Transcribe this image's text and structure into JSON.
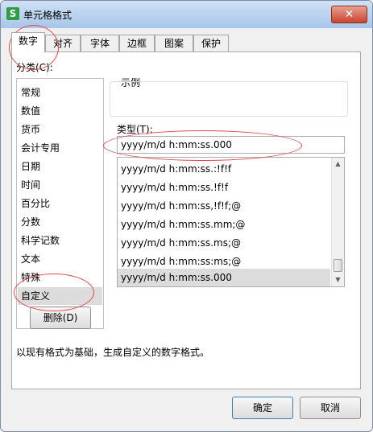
{
  "window": {
    "title": "单元格格式",
    "app_icon": "S",
    "close_glyph": "✕"
  },
  "tabs": [
    {
      "label": "数字",
      "active": true
    },
    {
      "label": "对齐"
    },
    {
      "label": "字体"
    },
    {
      "label": "边框"
    },
    {
      "label": "图案"
    },
    {
      "label": "保护"
    }
  ],
  "category": {
    "label": "分类(C):",
    "items": [
      "常规",
      "数值",
      "货币",
      "会计专用",
      "日期",
      "时间",
      "百分比",
      "分数",
      "科学记数",
      "文本",
      "特殊",
      "自定义"
    ],
    "selected": "自定义"
  },
  "delete_button": "删除(D)",
  "sample": {
    "label": "示例"
  },
  "type": {
    "label": "类型(T):",
    "value": "yyyy/m/d h:mm:ss.000",
    "items": [
      "yyyy/m/d h:mm:ss.:!f!f",
      "yyyy/m/d h:mm:ss.!f!f",
      "yyyy/m/d h:mm:ss,!f!f;@",
      "yyyy/m/d h:mm:ss.mm;@",
      "yyyy/m/d h:mm:ss.ms;@",
      "yyyy/m/d h:mm:ss:ms;@",
      "yyyy/m/d h:mm:ss.000"
    ],
    "selected": "yyyy/m/d h:mm:ss.000"
  },
  "hint": "以现有格式为基础，生成自定义的数字格式。",
  "buttons": {
    "ok": "确定",
    "cancel": "取消"
  },
  "colors": {
    "annotation": "#e2484a",
    "selection": "#dcdcdc",
    "title_bar": "#a8c6e9"
  },
  "icons": {
    "app": "wps-spreadsheet-icon",
    "close": "close-icon",
    "scroll_up": "chevron-up-icon",
    "scroll_down": "chevron-down-icon"
  }
}
